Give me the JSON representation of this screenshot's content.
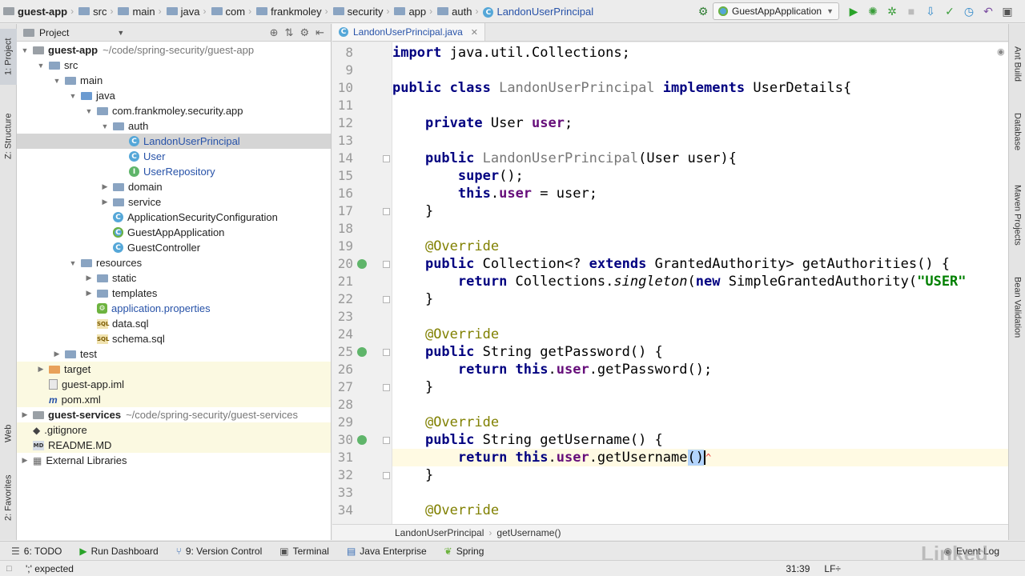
{
  "breadcrumbs": [
    "guest-app",
    "src",
    "main",
    "java",
    "com",
    "frankmoley",
    "security",
    "app",
    "auth",
    "LandonUserPrincipal"
  ],
  "run_config": {
    "label": "GuestAppApplication"
  },
  "left_strip": {
    "project": "1: Project",
    "structure": "Z: Structure",
    "web": "Web",
    "favorites": "2: Favorites"
  },
  "right_strip": {
    "ant": "Ant Build",
    "database": "Database",
    "maven": "Maven Projects",
    "bean": "Bean Validation"
  },
  "project_panel": {
    "title": "Project"
  },
  "tree": [
    {
      "name": "guest-app",
      "path": "~/code/spring-security/guest-app",
      "depth": 0,
      "arrow": "down",
      "icon": "module"
    },
    {
      "name": "src",
      "depth": 1,
      "arrow": "down",
      "icon": "folder"
    },
    {
      "name": "main",
      "depth": 2,
      "arrow": "down",
      "icon": "folder"
    },
    {
      "name": "java",
      "depth": 3,
      "arrow": "down",
      "icon": "folder-blue"
    },
    {
      "name": "com.frankmoley.security.app",
      "depth": 4,
      "arrow": "down",
      "icon": "folder"
    },
    {
      "name": "auth",
      "depth": 5,
      "arrow": "down",
      "icon": "folder"
    },
    {
      "name": "LandonUserPrincipal",
      "depth": 6,
      "arrow": "",
      "icon": "class",
      "style": "blue"
    },
    {
      "name": "User",
      "depth": 6,
      "arrow": "",
      "icon": "class",
      "style": "blue"
    },
    {
      "name": "UserRepository",
      "depth": 6,
      "arrow": "",
      "icon": "interface",
      "style": "blue"
    },
    {
      "name": "domain",
      "depth": 5,
      "arrow": "right",
      "icon": "folder"
    },
    {
      "name": "service",
      "depth": 5,
      "arrow": "right",
      "icon": "folder"
    },
    {
      "name": "ApplicationSecurityConfiguration",
      "depth": 5,
      "arrow": "",
      "icon": "class"
    },
    {
      "name": "GuestAppApplication",
      "depth": 5,
      "arrow": "",
      "icon": "spring"
    },
    {
      "name": "GuestController",
      "depth": 5,
      "arrow": "",
      "icon": "class"
    },
    {
      "name": "resources",
      "depth": 3,
      "arrow": "down",
      "icon": "folder"
    },
    {
      "name": "static",
      "depth": 4,
      "arrow": "right",
      "icon": "folder"
    },
    {
      "name": "templates",
      "depth": 4,
      "arrow": "right",
      "icon": "folder"
    },
    {
      "name": "application.properties",
      "depth": 4,
      "arrow": "",
      "icon": "properties",
      "style": "blue"
    },
    {
      "name": "data.sql",
      "depth": 4,
      "arrow": "",
      "icon": "sql"
    },
    {
      "name": "schema.sql",
      "depth": 4,
      "arrow": "",
      "icon": "sql"
    },
    {
      "name": "test",
      "depth": 2,
      "arrow": "right",
      "icon": "folder"
    },
    {
      "name": "target",
      "depth": 1,
      "arrow": "right",
      "icon": "folder-orange"
    },
    {
      "name": "guest-app.iml",
      "depth": 1,
      "arrow": "",
      "icon": "file"
    },
    {
      "name": "pom.xml",
      "depth": 1,
      "arrow": "",
      "icon": "maven"
    },
    {
      "name": "guest-services",
      "path": "~/code/spring-security/guest-services",
      "depth": 0,
      "arrow": "right",
      "icon": "module"
    },
    {
      "name": ".gitignore",
      "depth": 0,
      "arrow": "",
      "icon": "git"
    },
    {
      "name": "README.MD",
      "depth": 0,
      "arrow": "",
      "icon": "md"
    },
    {
      "name": "External Libraries",
      "depth": 0,
      "arrow": "right",
      "icon": "libs"
    }
  ],
  "editor": {
    "tab": "LandonUserPrincipal.java",
    "lines": [
      {
        "n": "8",
        "html": "<span class='kw'>import</span> java.util.Collections;"
      },
      {
        "n": "9",
        "html": ""
      },
      {
        "n": "10",
        "html": "<span class='kw'>public class</span> <span class='gry'>LandonUserPrincipal</span> <span class='kw'>implements</span> UserDetails{"
      },
      {
        "n": "11",
        "html": ""
      },
      {
        "n": "12",
        "html": "    <span class='kw'>private</span> User <span class='fld'>user</span>;"
      },
      {
        "n": "13",
        "html": ""
      },
      {
        "n": "14",
        "html": "    <span class='kw'>public</span> <span class='gry'>LandonUserPrincipal</span>(User user){"
      },
      {
        "n": "15",
        "html": "        <span class='kw'>super</span>();"
      },
      {
        "n": "16",
        "html": "        <span class='kw'>this</span>.<span class='fld'>user</span> = user;"
      },
      {
        "n": "17",
        "html": "    }"
      },
      {
        "n": "18",
        "html": ""
      },
      {
        "n": "19",
        "html": "    <span class='ann'>@Override</span>"
      },
      {
        "n": "20",
        "html": "    <span class='kw'>public</span> Collection&lt;? <span class='kw'>extends</span> GrantedAuthority&gt; getAuthorities() {"
      },
      {
        "n": "21",
        "html": "        <span class='kw'>return</span> Collections.<span class='itl'>singleton</span>(<span class='kw'>new</span> SimpleGrantedAuthority(<span class='str'>\"USER\"</span>"
      },
      {
        "n": "22",
        "html": "    }"
      },
      {
        "n": "23",
        "html": ""
      },
      {
        "n": "24",
        "html": "    <span class='ann'>@Override</span>"
      },
      {
        "n": "25",
        "html": "    <span class='kw'>public</span> String getPassword() {"
      },
      {
        "n": "26",
        "html": "        <span class='kw'>return this</span>.<span class='fld'>user</span>.getPassword();"
      },
      {
        "n": "27",
        "html": "    }"
      },
      {
        "n": "28",
        "html": ""
      },
      {
        "n": "29",
        "html": "    <span class='ann'>@Override</span>"
      },
      {
        "n": "30",
        "html": "    <span class='kw'>public</span> String getUsername() {"
      },
      {
        "n": "31",
        "html": "        <span class='kw'>return this</span>.<span class='fld'>user</span>.getUsername<span class='brk'>()</span><span class='caret'></span><span class='squig'>^</span>"
      },
      {
        "n": "32",
        "html": "    }"
      },
      {
        "n": "33",
        "html": ""
      },
      {
        "n": "34",
        "html": "    <span class='ann'>@Override</span>"
      }
    ],
    "current_line": "31",
    "crumbs": [
      "LandonUserPrincipal",
      "getUsername()"
    ]
  },
  "bottom_tools": [
    {
      "label": "6: TODO",
      "icon": "todo-icon"
    },
    {
      "label": "Run Dashboard",
      "icon": "run-icon"
    },
    {
      "label": "9: Version Control",
      "icon": "vcs-icon"
    },
    {
      "label": "Terminal",
      "icon": "terminal-icon"
    },
    {
      "label": "Java Enterprise",
      "icon": "javaee-icon"
    },
    {
      "label": "Spring",
      "icon": "spring-icon"
    }
  ],
  "event_log": "Event Log",
  "status": {
    "message": "';' expected",
    "position": "31:39",
    "line_sep": "LF÷"
  },
  "watermark": "Linked"
}
